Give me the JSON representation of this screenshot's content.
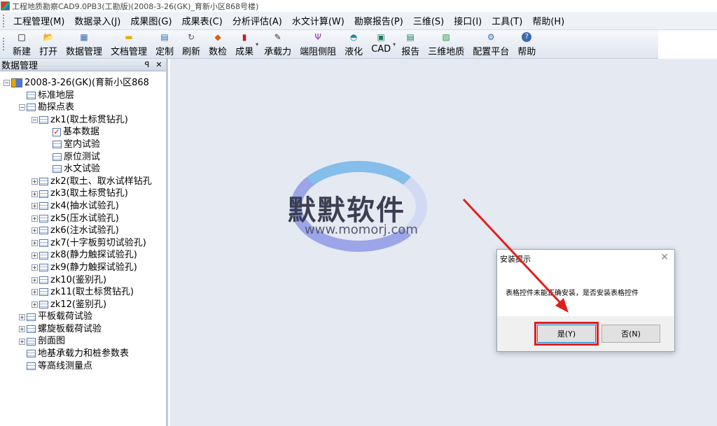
{
  "title": "工程地质勘察CAD9.0PB3(工勘版)(2008-3-26(GK)_育新小区868号楼)",
  "menu": [
    "工程管理(M)",
    "数据录入(J)",
    "成果图(G)",
    "成果表(C)",
    "分析评估(A)",
    "水文计算(W)",
    "勘察报告(P)",
    "三维(S)",
    "接口(I)",
    "工具(T)",
    "帮助(H)"
  ],
  "toolbar": [
    {
      "label": "新建",
      "icon": "□"
    },
    {
      "label": "打开",
      "icon": "📂"
    },
    {
      "label": "数据管理",
      "icon": "▦"
    },
    {
      "label": "文档管理",
      "icon": "▬"
    },
    {
      "label": "定制",
      "icon": "▤"
    },
    {
      "label": "刷新",
      "icon": "↻"
    },
    {
      "label": "数检",
      "icon": "◆"
    },
    {
      "label": "成果",
      "icon": "▮"
    },
    {
      "label": "承载力",
      "icon": "✎"
    },
    {
      "label": "端阻侧阻",
      "icon": "Ψ"
    },
    {
      "label": "液化",
      "icon": "◓"
    },
    {
      "label": "CAD",
      "icon": "▣"
    },
    {
      "label": "报告",
      "icon": "▤"
    },
    {
      "label": "三维地质",
      "icon": "▧"
    },
    {
      "label": "配置平台",
      "icon": "⚙"
    },
    {
      "label": "帮助",
      "icon": "?"
    }
  ],
  "panel": {
    "title": "数据管理",
    "pin": "ꟼ",
    "close": "✕"
  },
  "tree": {
    "root": "2008-3-26(GK)(育新小区868",
    "n1": "标准地层",
    "n2": "勘探点表",
    "zk1": "zk1(取土标贯钻孔)",
    "zk1a": "基本数据",
    "zk1b": "室内试验",
    "zk1c": "原位测试",
    "zk1d": "水文试验",
    "zk2": "zk2(取土、取水试样钻孔",
    "zk3": "zk3(取土标贯钻孔)",
    "zk4": "zk4(抽水试验孔)",
    "zk5": "zk5(压水试验孔)",
    "zk6": "zk6(注水试验孔)",
    "zk7": "zk7(十字板剪切试验孔)",
    "zk8": "zk8(静力触探试验孔)",
    "zk9": "zk9(静力触探试验孔)",
    "zk10": "zk10(鉴别孔)",
    "zk11": "zk11(取土标贯钻孔)",
    "zk12": "zk12(鉴别孔)",
    "n3": "平板载荷试验",
    "n4": "螺旋板载荷试验",
    "n5": "剖面图",
    "n6": "地基承载力和桩参数表",
    "n7": "等高线测量点"
  },
  "watermark": {
    "name": "默默软件",
    "url": "www.momorj.com"
  },
  "dialog": {
    "title": "安装提示",
    "message": "表格控件未能正确安装，是否安装表格控件",
    "yes": "是(Y)",
    "no": "否(N)",
    "close": "✕"
  },
  "colors": {
    "highlight": "#e0201c",
    "workspace": "#e4e9f2"
  }
}
